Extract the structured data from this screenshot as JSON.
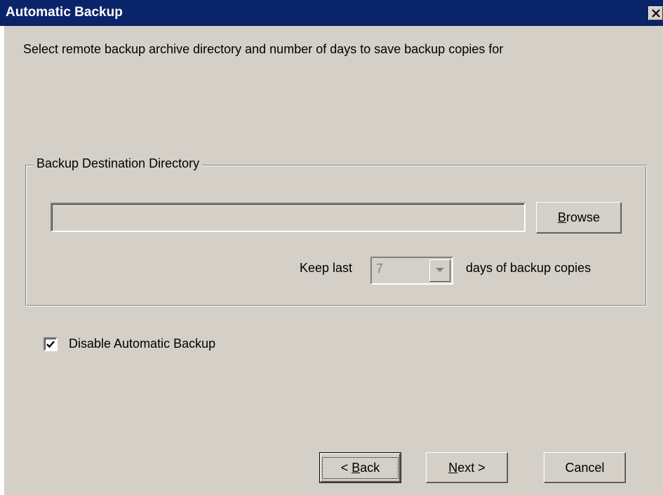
{
  "window": {
    "title": "Automatic Backup"
  },
  "instruction": "Select remote backup archive directory and number of days to save backup copies for",
  "destination_group": {
    "legend": "Backup Destination Directory",
    "path_value": "",
    "browse_label_accel": "B",
    "browse_label_rest": "rowse",
    "keep_label": "Keep last",
    "days_value": "7",
    "days_label": "days of backup copies"
  },
  "disable_checkbox": {
    "label": "Disable Automatic Backup",
    "checked": true
  },
  "buttons": {
    "back_prefix": "< ",
    "back_accel": "B",
    "back_rest": "ack",
    "next_accel": "N",
    "next_rest": "ext >",
    "cancel": "Cancel"
  }
}
